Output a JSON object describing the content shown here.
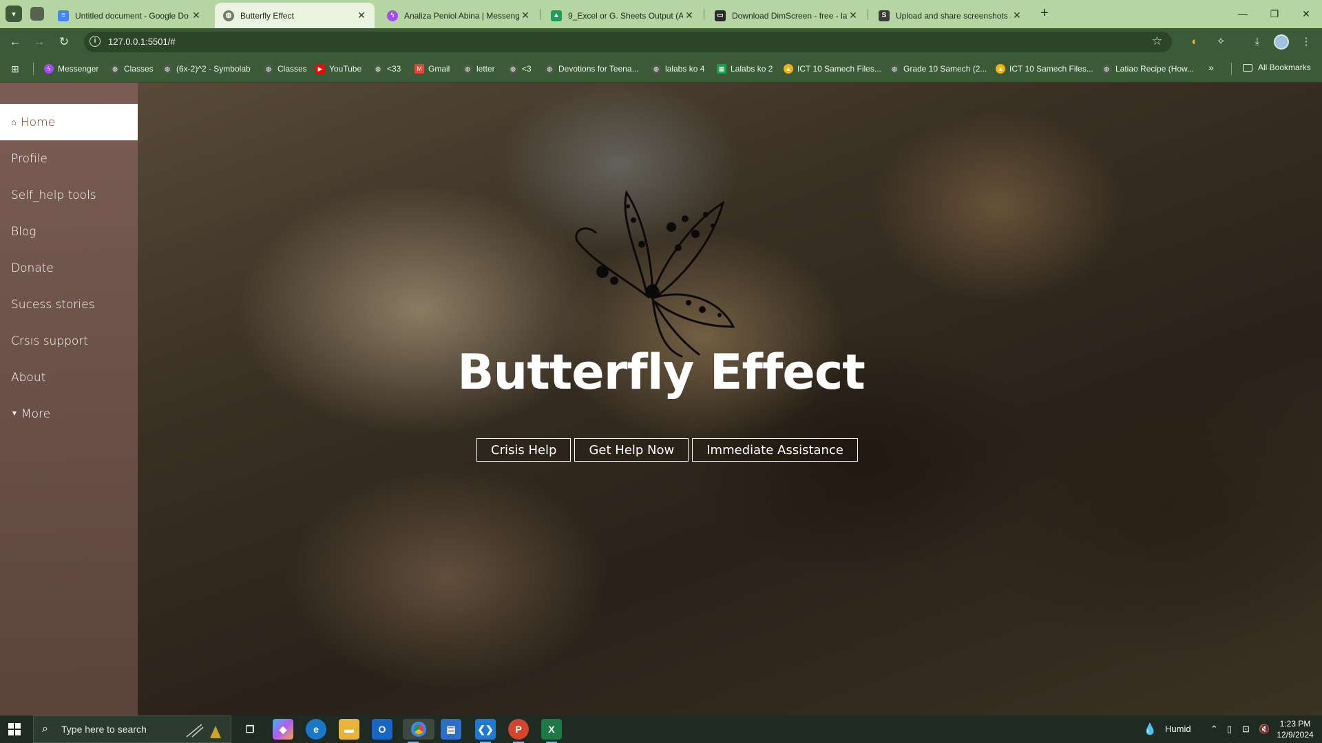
{
  "browser": {
    "tabs": [
      {
        "title": "Untitled document - Google Do",
        "favicon": "docs-icon",
        "color": "#4285f4",
        "active": false
      },
      {
        "title": "Butterfly Effect",
        "favicon": "globe-icon",
        "color": "#6b7d66",
        "active": true
      },
      {
        "title": "Analiza Peniol Abina | Messeng",
        "favicon": "messenger-icon",
        "color": "#a04cf0",
        "active": false
      },
      {
        "title": "9_Excel or G. Sheets Output (AC",
        "favicon": "drive-icon",
        "color": "#1e9e55",
        "active": false
      },
      {
        "title": "Download DimScreen - free - la",
        "favicon": "monitor-icon",
        "color": "#2a2a2a",
        "active": false
      },
      {
        "title": "Upload and share screenshots a",
        "favicon": "sb-icon",
        "color": "#3a3a3a",
        "active": false
      }
    ],
    "url": "127.0.0.1:5501/#",
    "bookmarks": [
      {
        "label": "Messenger",
        "icon": "messenger-icon",
        "color": "#a04cf0"
      },
      {
        "label": "Classes",
        "icon": "globe-icon",
        "color": "#4a5a46"
      },
      {
        "label": "(6x-2)^2 - Symbolab",
        "icon": "globe-icon",
        "color": "#4a5a46"
      },
      {
        "label": "Classes",
        "icon": "globe-icon",
        "color": "#4a5a46"
      },
      {
        "label": "YouTube",
        "icon": "youtube-icon",
        "color": "#ff0000"
      },
      {
        "label": "<33",
        "icon": "globe-icon",
        "color": "#4a5a46"
      },
      {
        "label": "Gmail",
        "icon": "gmail-icon",
        "color": "#ea4335"
      },
      {
        "label": "letter",
        "icon": "globe-icon",
        "color": "#4a5a46"
      },
      {
        "label": "<3",
        "icon": "globe-icon",
        "color": "#4a5a46"
      },
      {
        "label": "Devotions for Teena...",
        "icon": "globe-icon",
        "color": "#4a5a46"
      },
      {
        "label": "lalabs ko 4",
        "icon": "globe-icon",
        "color": "#4a5a46"
      },
      {
        "label": "Lalabs ko 2",
        "icon": "sheets-icon",
        "color": "#1e9e55"
      },
      {
        "label": "ICT 10 Samech Files...",
        "icon": "drive-icon",
        "color": "#f4b400"
      },
      {
        "label": "Grade 10 Samech (2...",
        "icon": "globe-icon",
        "color": "#4a5a46"
      },
      {
        "label": "ICT 10 Samech Files...",
        "icon": "drive-icon",
        "color": "#f4b400"
      },
      {
        "label": "Latiao Recipe (How...",
        "icon": "globe-icon",
        "color": "#4a5a46"
      }
    ],
    "all_bookmarks": "All Bookmarks"
  },
  "sidebar": {
    "items": [
      {
        "label": "Home",
        "active": true
      },
      {
        "label": "Profile"
      },
      {
        "label": "Self_help tools"
      },
      {
        "label": "Blog"
      },
      {
        "label": "Donate"
      },
      {
        "label": "Sucess stories"
      },
      {
        "label": "Crsis support"
      },
      {
        "label": "About"
      },
      {
        "label": "More"
      }
    ]
  },
  "hero": {
    "title": "Butterfly Effect",
    "buttons": [
      "Crisis Help",
      "Get Help Now",
      "Immediate Assistance"
    ]
  },
  "taskbar": {
    "search_placeholder": "Type here to search",
    "weather": "Humid",
    "time": "1:23 PM",
    "date": "12/9/2024"
  },
  "colors": {
    "browser_tabstrip": "#b5d6a3",
    "browser_toolbar": "#3b5a37",
    "sidebar": "#7d5f58",
    "sidebar_active_text": "#7a3b22"
  }
}
